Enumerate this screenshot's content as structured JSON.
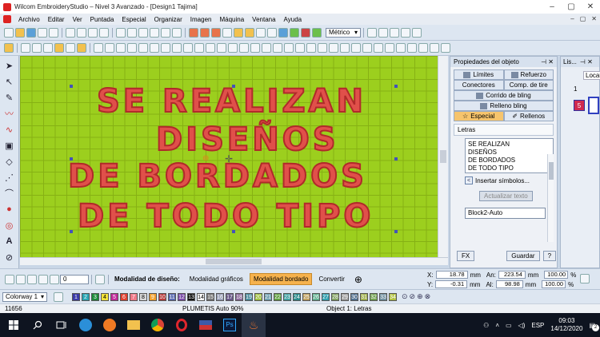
{
  "window": {
    "title": "Wilcom EmbroideryStudio – Nivel 3 Avanzado - [Design1          Tajima]",
    "controls": [
      "–",
      "▢",
      "✕"
    ]
  },
  "menu": {
    "items": [
      "Archivo",
      "Editar",
      "Ver",
      "Puntada",
      "Especial",
      "Organizar",
      "Imagen",
      "Máquina",
      "Ventana",
      "Ayuda"
    ],
    "window_controls": [
      "–",
      "▢",
      "✕"
    ]
  },
  "toolbar": {
    "units_value": "Métrico",
    "spin_value": "0"
  },
  "canvas": {
    "lines": [
      "SE REALIZAN",
      "DISEÑOS",
      "DE BORDADOS",
      "DE TODO TIPO"
    ],
    "fill_color": "#9ccf1e",
    "text_color": "#e0504a"
  },
  "properties": {
    "title": "Propiedades del objeto",
    "pin_icons": "⊣ ✕",
    "tabs_row1": [
      "Límites",
      "Refuerzo"
    ],
    "tabs_row2": [
      "Conectores",
      "Comp. de tire"
    ],
    "tabs_row3": [
      "Corrido de bling"
    ],
    "tabs_row4": [
      "Relleno bling"
    ],
    "tabs_row5": [
      "Especial",
      "Rellenos"
    ],
    "letters_label": "Letras",
    "text_lines": [
      "SE REALIZAN",
      " DISEÑOS",
      "DE BORDADOS",
      "DE TODO TIPO"
    ],
    "insert_symbols": "Insertar símbolos...",
    "update_text": "Actualizar texto",
    "font_value": "Block2-Auto",
    "fx_button": "FX",
    "save_button": "Guardar",
    "help_button": "?"
  },
  "lista": {
    "title": "Lis...",
    "pin": "⊣ ✕",
    "tab": "Locali",
    "num1": "1",
    "num2": "5"
  },
  "designbar": {
    "mode_label": "Modalidad de diseño:",
    "graphics_mode": "Modalidad gráficos",
    "embroidery_mode": "Modalidad bordado",
    "convert": "Convertir",
    "x_label": "X:",
    "x_value": "18.78",
    "y_label": "Y:",
    "y_value": "-0.31",
    "unit": "mm",
    "an_label": "An:",
    "an_value": "223.54",
    "al_label": "Al:",
    "al_value": "98.98",
    "pct1": "100.00",
    "pct2": "100.00",
    "pct_sign": "%"
  },
  "colorbar": {
    "colorway": "Colorway 1",
    "swatches": [
      "1",
      "2",
      "3",
      "4",
      "5",
      "6",
      "7",
      "8",
      "9",
      "10",
      "11",
      "12",
      "13",
      "14",
      "15",
      "16",
      "17",
      "18",
      "19",
      "20",
      "21",
      "22",
      "23",
      "24",
      "25",
      "26",
      "27",
      "28",
      "29",
      "30",
      "31",
      "32",
      "33",
      "34"
    ],
    "swatch_colors": [
      "#3a3aa8",
      "#2aa6b4",
      "#1d8a3a",
      "#f2e23a",
      "#c02a9a",
      "#e04030",
      "#f07a8a",
      "#d8d8d8",
      "#f0a030",
      "#b83a3a",
      "#5a6ab0",
      "#7a4aa8",
      "#111111",
      "#ffffff",
      "#777777",
      "#9aa0b8",
      "#6a5a8a",
      "#8a6a9a",
      "#4a8a9a",
      "#a0c040",
      "#70a0b0",
      "#60a040",
      "#40a0a0",
      "#2a8a8a",
      "#c0a060",
      "#60b090",
      "#30a0b0",
      "#80a060",
      "#a0a0a0",
      "#507090",
      "#a0b050",
      "#70a050",
      "#7090a0",
      "#b0c040"
    ]
  },
  "status": {
    "stitch_count": "11656",
    "stitch_type": "PLUMETIS Auto 90%",
    "object": "Object 1: Letras"
  },
  "taskbar": {
    "lang": "ESP",
    "time": "09:03",
    "date": "14/12/2020",
    "badge": "2"
  }
}
